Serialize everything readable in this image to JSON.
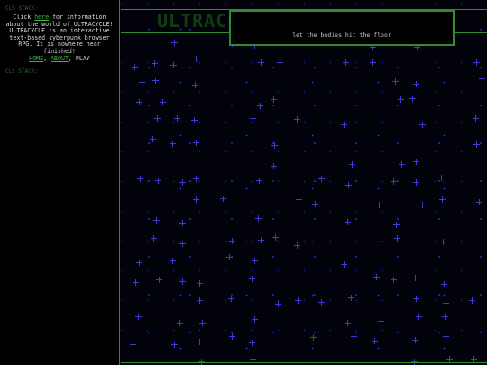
{
  "sidebar": {
    "top_tag": "CLS STACK:",
    "bottom_tag": "CLS STACK:",
    "info_prefix": "Click ",
    "info_link": "here",
    "info_suffix": " for information about the world of ULTRACYCLE!",
    "description": "ULTRACYCLE is an interactive text-based cyberpunk browser RPG. It is nowhere near finished!",
    "nav_home": "HOME",
    "nav_about": "ABOUT",
    "nav_play": "PLAY"
  },
  "main": {
    "title": "ULTRAC",
    "popup_text": "let the bodies hit the floor"
  }
}
